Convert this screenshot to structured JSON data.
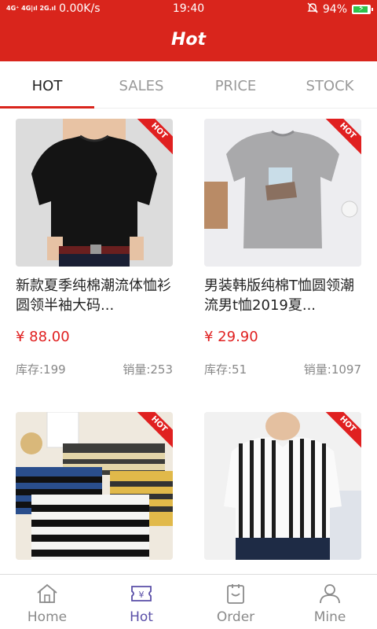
{
  "status_bar": {
    "signal": "4G⁺ 4G|ıl 2G.ıl",
    "network_speed": "0.00K/s",
    "time": "19:40",
    "battery": "94%",
    "battery_level": 0.94
  },
  "header": {
    "title": "Hot"
  },
  "tabs": [
    {
      "label": "HOT",
      "active": true
    },
    {
      "label": "SALES",
      "active": false
    },
    {
      "label": "PRICE",
      "active": false
    },
    {
      "label": "STOCK",
      "active": false
    }
  ],
  "hot_badge": "HOT",
  "products": [
    {
      "name": "新款夏季纯棉潮流体恤衫圆领半袖大码...",
      "price": "¥ 88.00",
      "stock": "库存:199",
      "sales": "销量:253",
      "image": "black-tshirt"
    },
    {
      "name": "男装韩版纯棉T恤圆领潮流男t恤2019夏...",
      "price": "¥ 29.90",
      "stock": "库存:51",
      "sales": "销量:1097",
      "image": "grey-tshirt"
    },
    {
      "name": "",
      "price": "",
      "stock": "",
      "sales": "",
      "image": "striped-tshirts"
    },
    {
      "name": "",
      "price": "",
      "stock": "",
      "sales": "",
      "image": "striped-shirt"
    }
  ],
  "bottom_nav": [
    {
      "label": "Home",
      "icon": "home-icon",
      "active": false
    },
    {
      "label": "Hot",
      "icon": "ticket-icon",
      "active": true
    },
    {
      "label": "Order",
      "icon": "order-icon",
      "active": false
    },
    {
      "label": "Mine",
      "icon": "user-icon",
      "active": false
    }
  ]
}
